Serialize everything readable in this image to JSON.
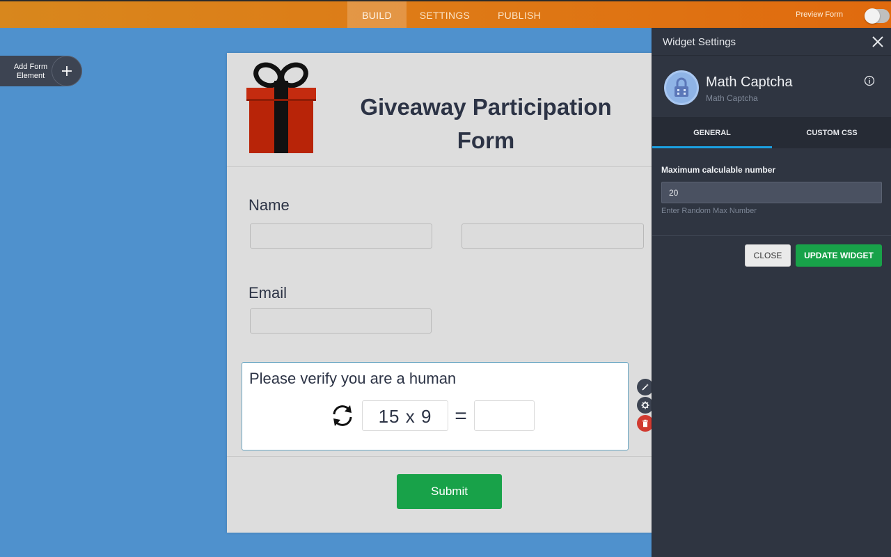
{
  "topbar": {
    "tabs": [
      {
        "label": "BUILD",
        "active": true
      },
      {
        "label": "SETTINGS",
        "active": false
      },
      {
        "label": "PUBLISH",
        "active": false
      }
    ],
    "preview_label": "Preview Form",
    "preview_enabled": false
  },
  "add_element": {
    "label_line1": "Add Form",
    "label_line2": "Element",
    "icon": "plus-icon"
  },
  "form": {
    "title_line1": "Giveaway Participation",
    "title_line2": "Form",
    "logo_icon": "gift-icon",
    "fields": {
      "name_label": "Name",
      "email_label": "Email"
    },
    "captcha": {
      "label": "Please verify you are a human",
      "question": "15 x 9",
      "equals": "=",
      "refresh_icon": "refresh-icon"
    },
    "tool_icons": [
      "wand-icon",
      "gear-icon",
      "trash-icon"
    ],
    "submit_label": "Submit"
  },
  "panel": {
    "title": "Widget Settings",
    "widget_name": "Math Captcha",
    "widget_subtitle": "Math Captcha",
    "tabs": [
      {
        "label": "GENERAL",
        "active": true
      },
      {
        "label": "CUSTOM CSS",
        "active": false
      }
    ],
    "setting": {
      "label": "Maximum calculable number",
      "value": "20",
      "hint": "Enter Random Max Number"
    },
    "close_label": "CLOSE",
    "update_label": "UPDATE WIDGET"
  },
  "colors": {
    "topbar": "#de7a16",
    "canvas": "#4f91cd",
    "panel": "#2f3541",
    "accent_green": "#18a249",
    "tab_underline": "#1ba0e1",
    "danger": "#d13a30"
  }
}
